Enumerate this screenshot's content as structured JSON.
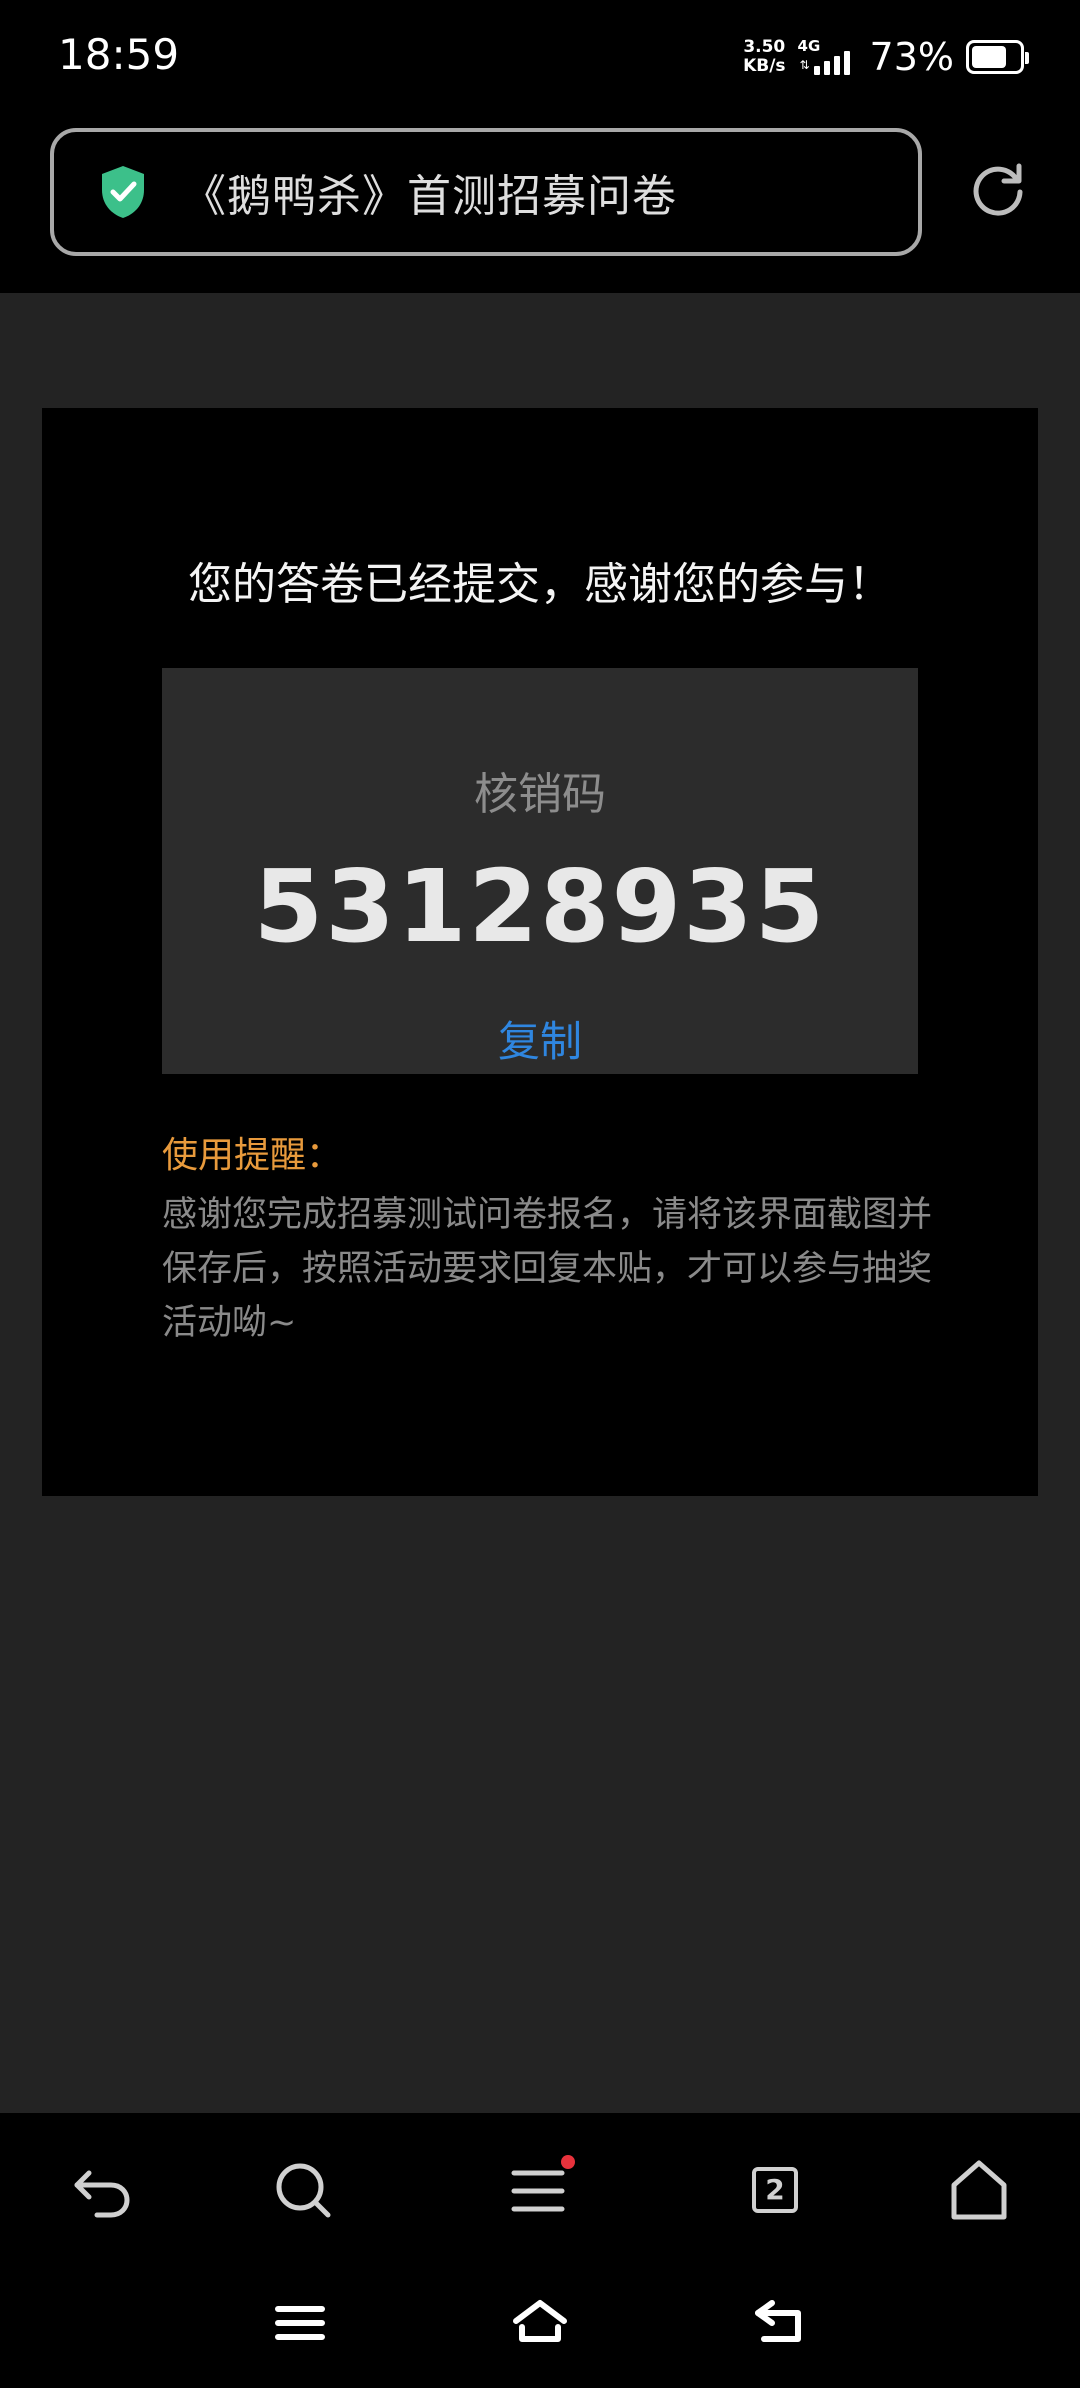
{
  "status_bar": {
    "time": "18:59",
    "net_speed_value": "3.50",
    "net_speed_unit": "KB/s",
    "network": "4G",
    "battery_percent": "73%",
    "battery_level": 0.73
  },
  "address_bar": {
    "page_title": "《鹅鸭杀》首测招募问卷",
    "security_icon": "shield-check-icon",
    "reload_icon": "reload-icon",
    "security_color": "#3cc08a"
  },
  "card": {
    "thanks_message": "您的答卷已经提交，感谢您的参与！",
    "code_label": "核销码",
    "code_value": "53128935",
    "copy_label": "复制",
    "reminder_title": "使用提醒：",
    "reminder_body": "感谢您完成招募测试问卷报名，请将该界面截图并保存后，按照活动要求回复本贴，才可以参与抽奖活动呦~"
  },
  "toolbar": {
    "back_icon": "back-icon",
    "search_icon": "search-icon",
    "menu_icon": "menu-icon",
    "tabs_count": "2",
    "home_icon": "home-icon"
  },
  "navigation_bar": {
    "menu_icon": "nav-menu-icon",
    "home_icon": "nav-home-icon",
    "back_icon": "nav-back-icon"
  }
}
